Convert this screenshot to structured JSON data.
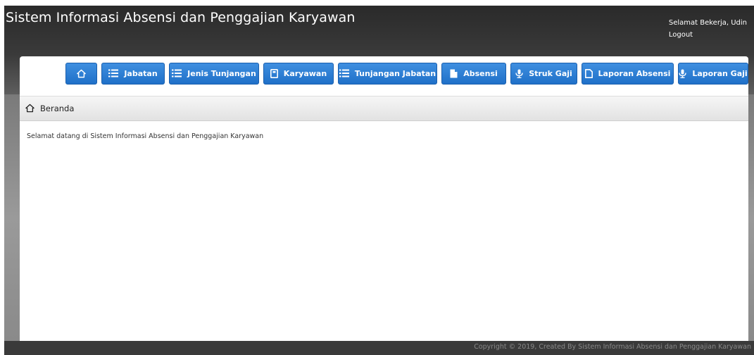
{
  "header": {
    "title": "Sistem Informasi Absensi dan Penggajian Karyawan",
    "greeting": "Selamat Bekerja, Udin",
    "logout_label": "Logout"
  },
  "nav": {
    "items": [
      {
        "label": "",
        "icon": "home-icon"
      },
      {
        "label": "Jabatan",
        "icon": "list-icon"
      },
      {
        "label": "Jenis Tunjangan",
        "icon": "list-icon"
      },
      {
        "label": "Karyawan",
        "icon": "book-icon"
      },
      {
        "label": "Tunjangan Jabatan",
        "icon": "list-icon"
      },
      {
        "label": "Absensi",
        "icon": "file-icon"
      },
      {
        "label": "Struk Gaji",
        "icon": "microphone-icon"
      },
      {
        "label": "Laporan Absensi",
        "icon": "file-outline-icon"
      },
      {
        "label": "Laporan Gaji",
        "icon": "microphone-icon"
      }
    ],
    "accent": "#2b7fd6"
  },
  "breadcrumb": {
    "label": "Beranda",
    "icon": "home-icon"
  },
  "main": {
    "welcome": "Selamat datang di Sistem Informasi Absensi dan Penggajian Karyawan"
  },
  "footer": {
    "copyright": "Copyright © 2019, Created By Sistem Informasi Absensi dan Penggajian Karyawan"
  }
}
